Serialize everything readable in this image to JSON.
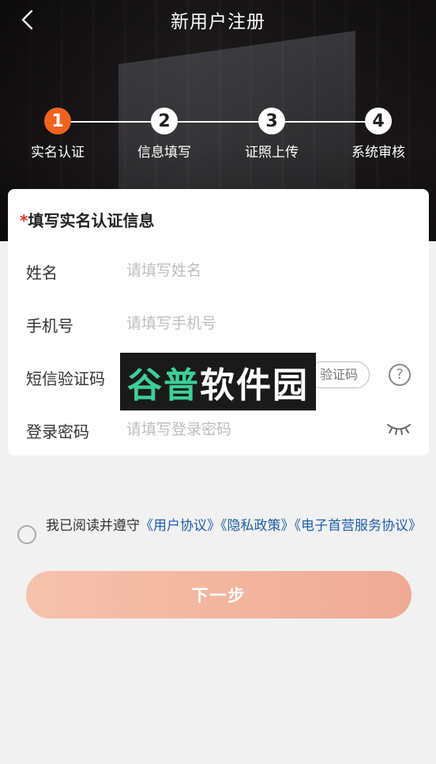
{
  "header": {
    "title": "新用户注册",
    "back_icon": "chevron-left-icon"
  },
  "steps": [
    {
      "number": "1",
      "label": "实名认证",
      "active": true
    },
    {
      "number": "2",
      "label": "信息填写",
      "active": false
    },
    {
      "number": "3",
      "label": "证照上传",
      "active": false
    },
    {
      "number": "4",
      "label": "系统审核",
      "active": false
    }
  ],
  "form": {
    "title_required_mark": "*",
    "title": "填写实名认证信息",
    "name": {
      "label": "姓名",
      "placeholder": "请填写姓名",
      "value": ""
    },
    "phone": {
      "label": "手机号",
      "placeholder": "请填写手机号",
      "value": ""
    },
    "sms": {
      "label": "短信验证码",
      "button_label": "获取验证码",
      "visible_button_text": "验证码",
      "help_icon": "question-circle-icon"
    },
    "password": {
      "label": "登录密码",
      "placeholder": "请填写登录密码",
      "value": "",
      "toggle_icon": "eye-closed-icon"
    }
  },
  "watermark": {
    "part1": "谷普",
    "part2": "软件园"
  },
  "agreement": {
    "prefix": "我已阅读并遵守",
    "link1": "《用户协议》",
    "link2": "《隐私政策》",
    "link3": "《电子首营服务协议》"
  },
  "next_button_label": "下一步",
  "colors": {
    "accent": "#f2621f",
    "link": "#1f5fa8",
    "button_gradient_start": "#f6c2ab",
    "button_gradient_end": "#efaa94",
    "required": "#e0322a"
  }
}
